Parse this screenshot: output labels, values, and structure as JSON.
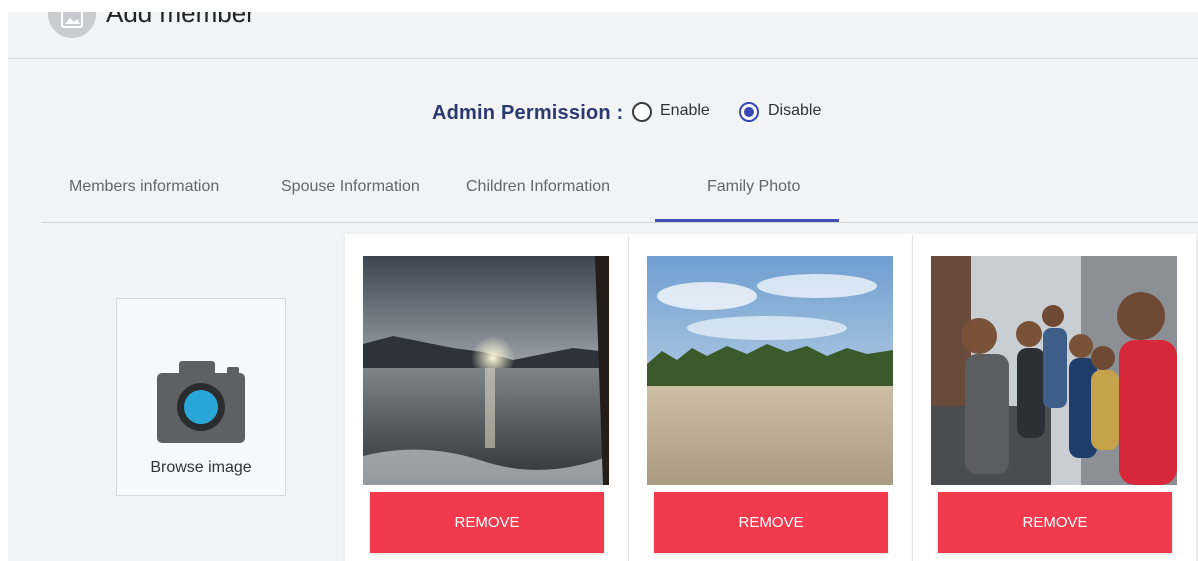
{
  "header": {
    "title": "Add member",
    "icon": "image-icon"
  },
  "permission": {
    "label": "Admin Permission :",
    "options": [
      {
        "label": "Enable",
        "selected": false
      },
      {
        "label": "Disable",
        "selected": true
      }
    ]
  },
  "tabs": [
    {
      "label": "Members information",
      "active": false
    },
    {
      "label": "Spouse Information",
      "active": false
    },
    {
      "label": "Children Information",
      "active": false
    },
    {
      "label": "Family Photo",
      "active": true
    }
  ],
  "browse": {
    "label": "Browse image",
    "icon": "camera-icon"
  },
  "photos": [
    {
      "description_icon": "sunset-lake-photo",
      "remove_label": "REMOVE"
    },
    {
      "description_icon": "beach-palms-photo",
      "remove_label": "REMOVE"
    },
    {
      "description_icon": "group-selfie-photo",
      "remove_label": "REMOVE"
    }
  ],
  "colors": {
    "accent": "#3f51b5",
    "remove": "#f23a4f",
    "title": "#2a3a70"
  }
}
